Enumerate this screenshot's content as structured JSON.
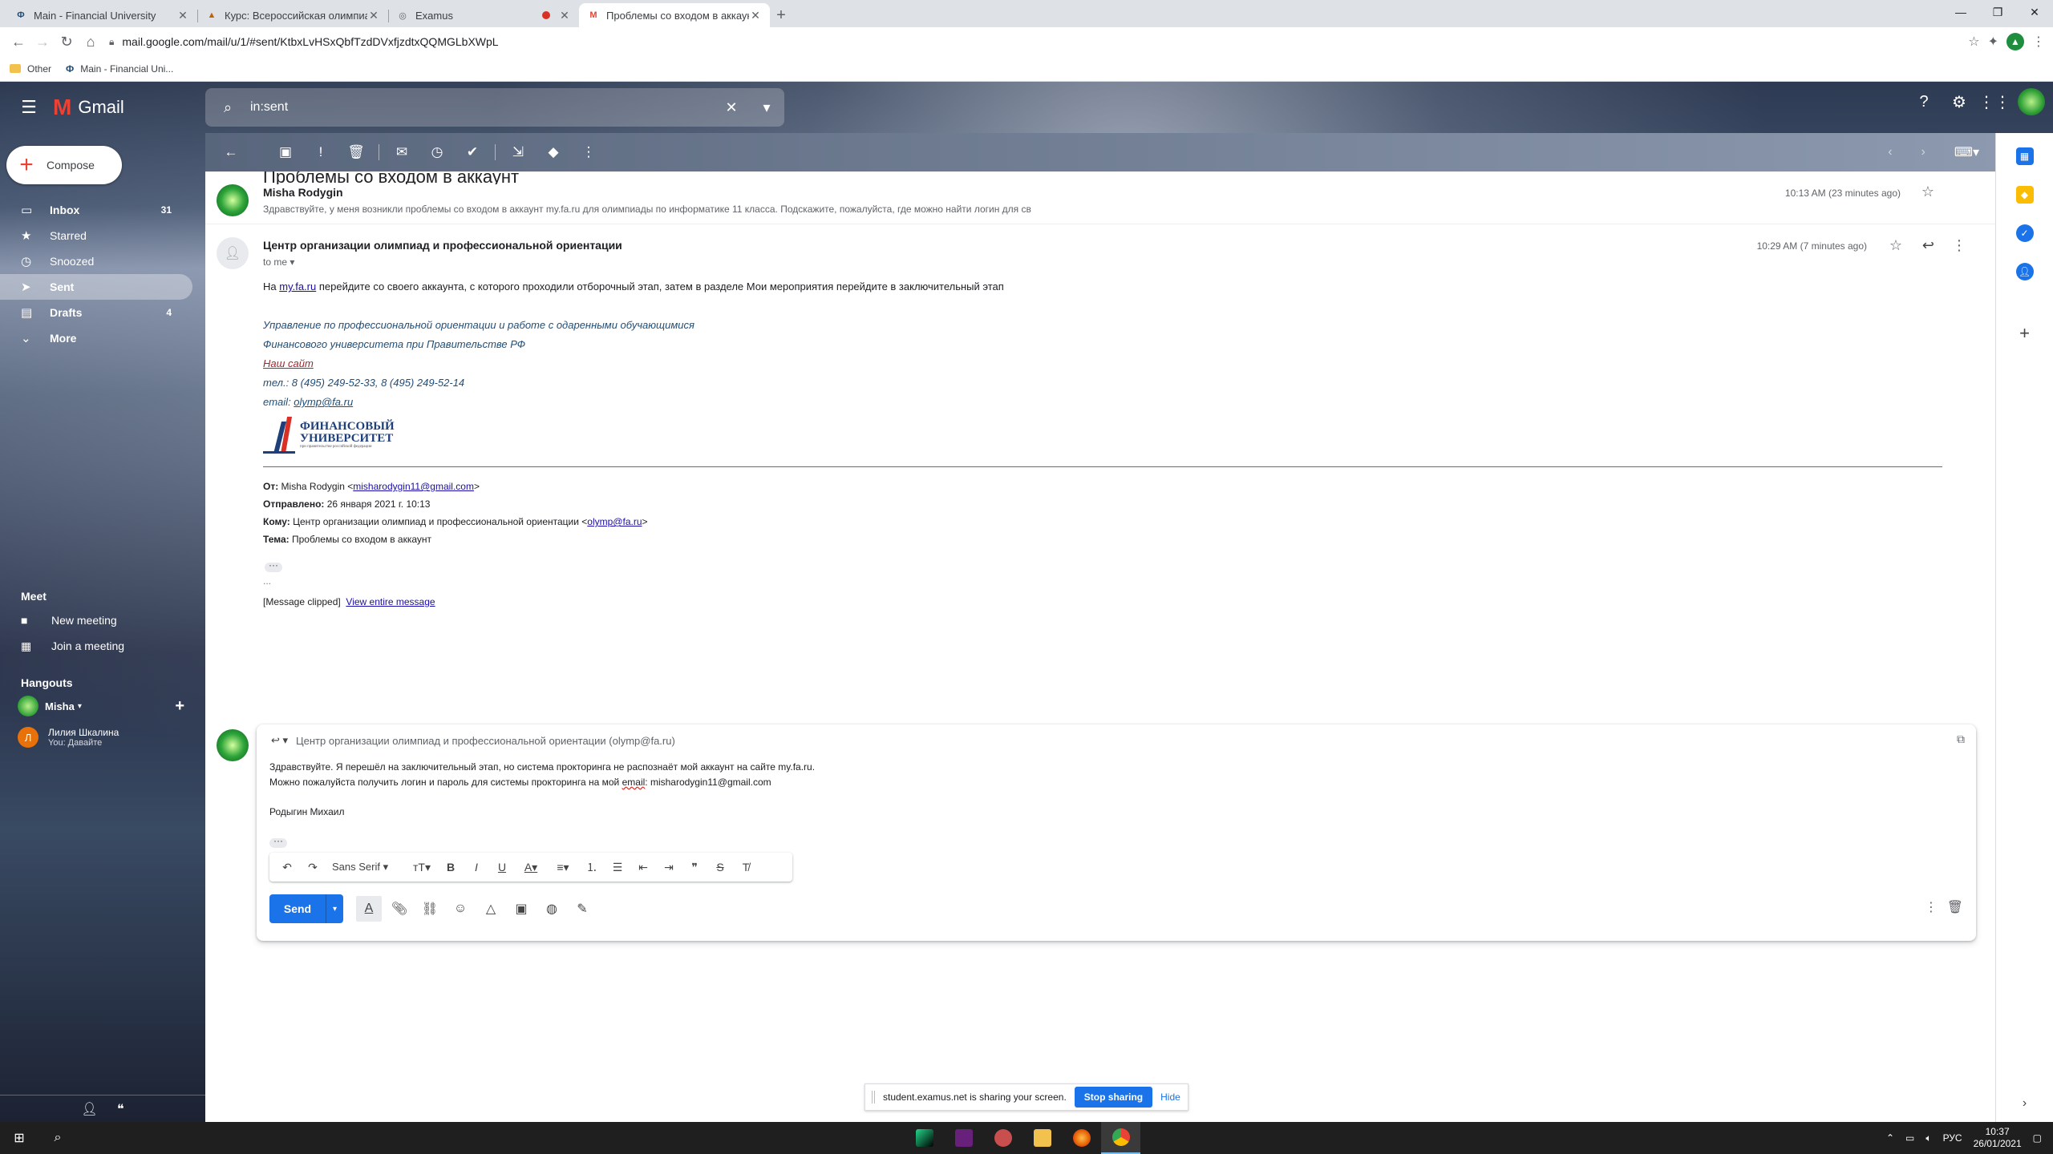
{
  "browser": {
    "tabs": [
      {
        "title": "Main - Financial University",
        "favicon": "fu-icon"
      },
      {
        "title": "Курс: Всероссийская олимпиада",
        "favicon": "course-icon"
      },
      {
        "title": "Examus",
        "favicon": "globe-icon",
        "recording": true
      },
      {
        "title": "Проблемы со входом в аккаунт",
        "favicon": "gmail-icon",
        "active": true
      }
    ],
    "url": "mail.google.com/mail/u/1/#sent/KtbxLvHSxQbfTzdDVxfjzdtxQQMGLbXWpL",
    "bookmarks": [
      "Other",
      "Main - Financial Uni..."
    ]
  },
  "gmail": {
    "brand": "Gmail",
    "search_value": "in:sent",
    "compose_label": "Compose",
    "nav": [
      {
        "label": "Inbox",
        "count": "31",
        "icon": "inbox-icon",
        "bold": true
      },
      {
        "label": "Starred",
        "count": "",
        "icon": "star-icon"
      },
      {
        "label": "Snoozed",
        "count": "",
        "icon": "clock-icon"
      },
      {
        "label": "Sent",
        "count": "",
        "icon": "send-icon",
        "active": true
      },
      {
        "label": "Drafts",
        "count": "4",
        "icon": "draft-icon",
        "bold": true
      },
      {
        "label": "More",
        "count": "",
        "icon": "chevron-down-icon"
      }
    ],
    "meet": {
      "title": "Meet",
      "items": [
        "New meeting",
        "Join a meeting"
      ]
    },
    "hangouts": {
      "title": "Hangouts",
      "user": "Misha",
      "contact_name": "Лилия Шкалина",
      "contact_status": "You: Давайте",
      "contact_initial": "Л"
    }
  },
  "thread": {
    "subject": "Проблемы со входом в аккаунт",
    "message1": {
      "sender": "Misha Rodygin",
      "snippet": "Здравствуйте, у меня возникли проблемы со входом в аккаунт my.fa.ru для олимпиады по информатике 11 класса. Подскажите, пожалуйста, где можно найти логин для св",
      "time": "10:13 AM (23 minutes ago)"
    },
    "message2": {
      "sender": "Центр организации олимпиад и профессиональной ориентации",
      "to": "to me",
      "time": "10:29 AM (7 minutes ago)",
      "body_prefix": "На ",
      "body_link": "my.fa.ru",
      "body_rest": " перейдите со своего аккаунта, с которого проходили отборочный этап, затем в разделе Мои мероприятия перейдите в заключительный этап",
      "sig_line1": "Управление по профессиональной ориентации и работе с одаренными обучающимися",
      "sig_line2": "Финансового университета при Правительстве РФ",
      "sig_site": "Наш сайт",
      "sig_phone": "тел.: 8 (495) 249-52-33, 8 (495) 249-52-14",
      "sig_email_label": "email: ",
      "sig_email": "olymp@fa.ru",
      "logo_line1": "ФИНАНСОВЫЙ",
      "logo_line2": "УНИВЕРСИТЕТ",
      "logo_small": "при правительстве российской федерации",
      "fwd_from_label": "От:",
      "fwd_from": " Misha Rodygin <",
      "fwd_from_email": "misharodygin11@gmail.com",
      "fwd_from_end": ">",
      "fwd_sent_label": "Отправлено:",
      "fwd_sent": " 26 января 2021 г. 10:13",
      "fwd_to_label": "Кому:",
      "fwd_to": " Центр организации олимпиад и профессиональной ориентации <",
      "fwd_to_email": "olymp@fa.ru",
      "fwd_to_end": ">",
      "fwd_subj_label": "Тема:",
      "fwd_subj": " Проблемы со входом в аккаунт",
      "ellipsis": "...",
      "clipped": "[Message clipped]",
      "view_entire": "View entire message"
    },
    "reply": {
      "recipient": "Центр организации олимпиад и профессиональной ориентации (olymp@fa.ru)",
      "line1": "Здравствуйте. Я перешёл на заключительный этап, но система прокторинга не распознаёт мой аккаунт на сайте my.fa.ru.",
      "line2_pre": "Можно пожалуйста получить логин и пароль для системы прокторинга на мой ",
      "line2_err": "email",
      "line2_post": ": misharodygin11@gmail.com",
      "line3": "Родыгин Михаил",
      "font": "Sans Serif",
      "send": "Send"
    }
  },
  "share_banner": {
    "text": "student.examus.net is sharing your screen.",
    "stop": "Stop sharing",
    "hide": "Hide"
  },
  "taskbar": {
    "lang": "РУС",
    "time": "10:37",
    "date": "26/01/2021"
  },
  "colors": {
    "accent": "#1a73e8",
    "gmail_red": "#ea4335",
    "sig_blue": "#1f4e79"
  }
}
